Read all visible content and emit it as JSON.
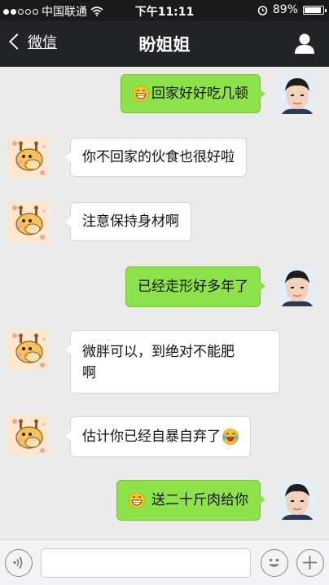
{
  "status_bar": {
    "carrier": "中国联通",
    "time": "下午11:11",
    "battery_percent": "89%",
    "battery_level": 0.89
  },
  "nav": {
    "back_label": "微信",
    "title": "盼姐姐"
  },
  "messages": [
    {
      "sender": "me",
      "text": "回家好好吃几顿",
      "emoji": "grin"
    },
    {
      "sender": "her",
      "text": "你不回家的伙食也很好啦"
    },
    {
      "sender": "her",
      "text": "注意保持身材啊"
    },
    {
      "sender": "me",
      "text": "已经走形好多年了"
    },
    {
      "sender": "her",
      "text_line1": "微胖可以，到绝对不能肥",
      "text_line2": "啊"
    },
    {
      "sender": "her",
      "text": "估计你已经自暴自弃了",
      "emoji": "laugh-tears"
    },
    {
      "sender": "me",
      "text": "送二十斤肉给你",
      "emoji": "grin"
    }
  ],
  "icons": {
    "back": "chevron-left-icon",
    "profile": "person-icon",
    "voice": "voice-icon",
    "emoji": "emoji-icon",
    "add": "plus-icon"
  },
  "colors": {
    "my_bubble": "#8ee34b",
    "her_bubble": "#ffffff",
    "nav_bg": "#232427",
    "chat_bg": "#ebebeb"
  }
}
